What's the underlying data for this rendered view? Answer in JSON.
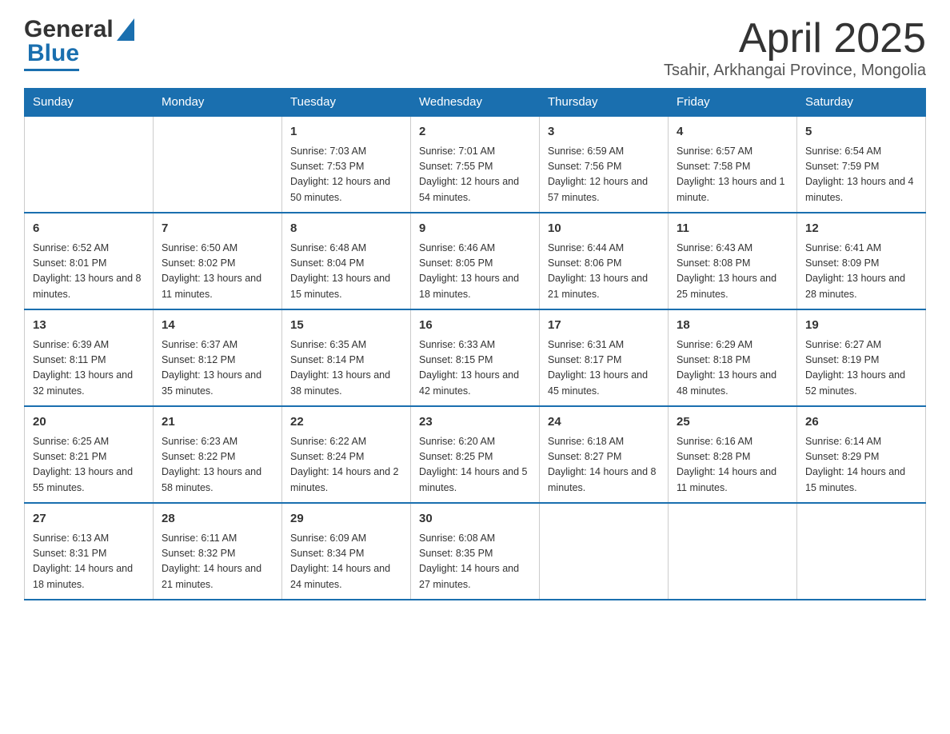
{
  "header": {
    "logo_text_general": "General",
    "logo_text_blue": "Blue",
    "month_title": "April 2025",
    "location": "Tsahir, Arkhangai Province, Mongolia"
  },
  "days_of_week": [
    "Sunday",
    "Monday",
    "Tuesday",
    "Wednesday",
    "Thursday",
    "Friday",
    "Saturday"
  ],
  "weeks": [
    [
      {
        "day": "",
        "sunrise": "",
        "sunset": "",
        "daylight": ""
      },
      {
        "day": "",
        "sunrise": "",
        "sunset": "",
        "daylight": ""
      },
      {
        "day": "1",
        "sunrise": "Sunrise: 7:03 AM",
        "sunset": "Sunset: 7:53 PM",
        "daylight": "Daylight: 12 hours and 50 minutes."
      },
      {
        "day": "2",
        "sunrise": "Sunrise: 7:01 AM",
        "sunset": "Sunset: 7:55 PM",
        "daylight": "Daylight: 12 hours and 54 minutes."
      },
      {
        "day": "3",
        "sunrise": "Sunrise: 6:59 AM",
        "sunset": "Sunset: 7:56 PM",
        "daylight": "Daylight: 12 hours and 57 minutes."
      },
      {
        "day": "4",
        "sunrise": "Sunrise: 6:57 AM",
        "sunset": "Sunset: 7:58 PM",
        "daylight": "Daylight: 13 hours and 1 minute."
      },
      {
        "day": "5",
        "sunrise": "Sunrise: 6:54 AM",
        "sunset": "Sunset: 7:59 PM",
        "daylight": "Daylight: 13 hours and 4 minutes."
      }
    ],
    [
      {
        "day": "6",
        "sunrise": "Sunrise: 6:52 AM",
        "sunset": "Sunset: 8:01 PM",
        "daylight": "Daylight: 13 hours and 8 minutes."
      },
      {
        "day": "7",
        "sunrise": "Sunrise: 6:50 AM",
        "sunset": "Sunset: 8:02 PM",
        "daylight": "Daylight: 13 hours and 11 minutes."
      },
      {
        "day": "8",
        "sunrise": "Sunrise: 6:48 AM",
        "sunset": "Sunset: 8:04 PM",
        "daylight": "Daylight: 13 hours and 15 minutes."
      },
      {
        "day": "9",
        "sunrise": "Sunrise: 6:46 AM",
        "sunset": "Sunset: 8:05 PM",
        "daylight": "Daylight: 13 hours and 18 minutes."
      },
      {
        "day": "10",
        "sunrise": "Sunrise: 6:44 AM",
        "sunset": "Sunset: 8:06 PM",
        "daylight": "Daylight: 13 hours and 21 minutes."
      },
      {
        "day": "11",
        "sunrise": "Sunrise: 6:43 AM",
        "sunset": "Sunset: 8:08 PM",
        "daylight": "Daylight: 13 hours and 25 minutes."
      },
      {
        "day": "12",
        "sunrise": "Sunrise: 6:41 AM",
        "sunset": "Sunset: 8:09 PM",
        "daylight": "Daylight: 13 hours and 28 minutes."
      }
    ],
    [
      {
        "day": "13",
        "sunrise": "Sunrise: 6:39 AM",
        "sunset": "Sunset: 8:11 PM",
        "daylight": "Daylight: 13 hours and 32 minutes."
      },
      {
        "day": "14",
        "sunrise": "Sunrise: 6:37 AM",
        "sunset": "Sunset: 8:12 PM",
        "daylight": "Daylight: 13 hours and 35 minutes."
      },
      {
        "day": "15",
        "sunrise": "Sunrise: 6:35 AM",
        "sunset": "Sunset: 8:14 PM",
        "daylight": "Daylight: 13 hours and 38 minutes."
      },
      {
        "day": "16",
        "sunrise": "Sunrise: 6:33 AM",
        "sunset": "Sunset: 8:15 PM",
        "daylight": "Daylight: 13 hours and 42 minutes."
      },
      {
        "day": "17",
        "sunrise": "Sunrise: 6:31 AM",
        "sunset": "Sunset: 8:17 PM",
        "daylight": "Daylight: 13 hours and 45 minutes."
      },
      {
        "day": "18",
        "sunrise": "Sunrise: 6:29 AM",
        "sunset": "Sunset: 8:18 PM",
        "daylight": "Daylight: 13 hours and 48 minutes."
      },
      {
        "day": "19",
        "sunrise": "Sunrise: 6:27 AM",
        "sunset": "Sunset: 8:19 PM",
        "daylight": "Daylight: 13 hours and 52 minutes."
      }
    ],
    [
      {
        "day": "20",
        "sunrise": "Sunrise: 6:25 AM",
        "sunset": "Sunset: 8:21 PM",
        "daylight": "Daylight: 13 hours and 55 minutes."
      },
      {
        "day": "21",
        "sunrise": "Sunrise: 6:23 AM",
        "sunset": "Sunset: 8:22 PM",
        "daylight": "Daylight: 13 hours and 58 minutes."
      },
      {
        "day": "22",
        "sunrise": "Sunrise: 6:22 AM",
        "sunset": "Sunset: 8:24 PM",
        "daylight": "Daylight: 14 hours and 2 minutes."
      },
      {
        "day": "23",
        "sunrise": "Sunrise: 6:20 AM",
        "sunset": "Sunset: 8:25 PM",
        "daylight": "Daylight: 14 hours and 5 minutes."
      },
      {
        "day": "24",
        "sunrise": "Sunrise: 6:18 AM",
        "sunset": "Sunset: 8:27 PM",
        "daylight": "Daylight: 14 hours and 8 minutes."
      },
      {
        "day": "25",
        "sunrise": "Sunrise: 6:16 AM",
        "sunset": "Sunset: 8:28 PM",
        "daylight": "Daylight: 14 hours and 11 minutes."
      },
      {
        "day": "26",
        "sunrise": "Sunrise: 6:14 AM",
        "sunset": "Sunset: 8:29 PM",
        "daylight": "Daylight: 14 hours and 15 minutes."
      }
    ],
    [
      {
        "day": "27",
        "sunrise": "Sunrise: 6:13 AM",
        "sunset": "Sunset: 8:31 PM",
        "daylight": "Daylight: 14 hours and 18 minutes."
      },
      {
        "day": "28",
        "sunrise": "Sunrise: 6:11 AM",
        "sunset": "Sunset: 8:32 PM",
        "daylight": "Daylight: 14 hours and 21 minutes."
      },
      {
        "day": "29",
        "sunrise": "Sunrise: 6:09 AM",
        "sunset": "Sunset: 8:34 PM",
        "daylight": "Daylight: 14 hours and 24 minutes."
      },
      {
        "day": "30",
        "sunrise": "Sunrise: 6:08 AM",
        "sunset": "Sunset: 8:35 PM",
        "daylight": "Daylight: 14 hours and 27 minutes."
      },
      {
        "day": "",
        "sunrise": "",
        "sunset": "",
        "daylight": ""
      },
      {
        "day": "",
        "sunrise": "",
        "sunset": "",
        "daylight": ""
      },
      {
        "day": "",
        "sunrise": "",
        "sunset": "",
        "daylight": ""
      }
    ]
  ]
}
